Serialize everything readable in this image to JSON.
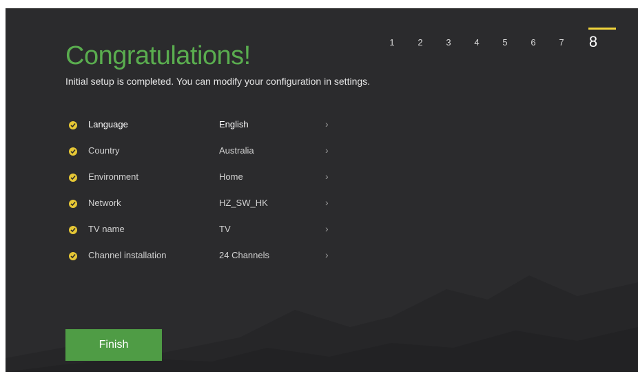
{
  "header": {
    "title": "Congratulations!",
    "subtitle": "Initial setup is completed. You can modify your configuration in settings."
  },
  "steps": {
    "items": [
      "1",
      "2",
      "3",
      "4",
      "5",
      "6",
      "7",
      "8"
    ],
    "current": "8"
  },
  "summary": {
    "items": [
      {
        "label": "Language",
        "value": "English",
        "icon": "check-circle-icon"
      },
      {
        "label": "Country",
        "value": "Australia",
        "icon": "check-circle-icon"
      },
      {
        "label": "Environment",
        "value": "Home",
        "icon": "check-circle-icon"
      },
      {
        "label": "Network",
        "value": "HZ_SW_HK",
        "icon": "check-circle-icon"
      },
      {
        "label": "TV name",
        "value": "TV",
        "icon": "check-circle-icon"
      },
      {
        "label": "Channel installation",
        "value": "24 Channels",
        "icon": "check-circle-icon"
      }
    ],
    "chevron": "›"
  },
  "footer": {
    "finish_label": "Finish"
  },
  "colors": {
    "background": "#2b2b2d",
    "title_green": "#5aad4f",
    "button_green": "#4f9c45",
    "accent_yellow": "#f2d53b"
  }
}
